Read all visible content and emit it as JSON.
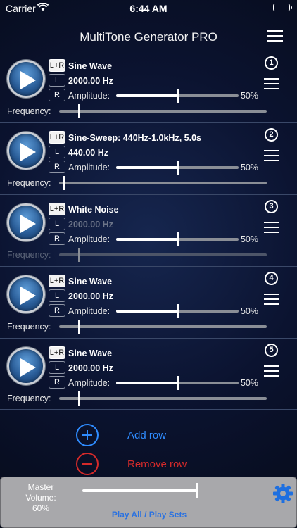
{
  "status_bar": {
    "carrier": "Carrier",
    "time": "6:44 AM"
  },
  "nav": {
    "title": "MultiTone Generator PRO",
    "menu_icon": "hamburger-menu-icon"
  },
  "rows": [
    {
      "number": "1",
      "channel": "L+R",
      "left": "L",
      "right": "R",
      "wave": "Sine Wave",
      "frequency": "2000.00 Hz",
      "frequency_enabled": true,
      "amplitude_label": "Amplitude:",
      "amplitude_pct": "50%",
      "amplitude": 0.5,
      "frequency_label": "Frequency:",
      "frequency_slider": 0.09
    },
    {
      "number": "2",
      "channel": "L+R",
      "left": "L",
      "right": "R",
      "wave": "Sine-Sweep: 440Hz-1.0kHz, 5.0s",
      "frequency": "440.00 Hz",
      "frequency_enabled": true,
      "amplitude_label": "Amplitude:",
      "amplitude_pct": "50%",
      "amplitude": 0.5,
      "frequency_label": "Frequency:",
      "frequency_slider": 0.02
    },
    {
      "number": "3",
      "channel": "L+R",
      "left": "L",
      "right": "R",
      "wave": "White Noise",
      "frequency": "2000.00 Hz",
      "frequency_enabled": false,
      "amplitude_label": "Amplitude:",
      "amplitude_pct": "50%",
      "amplitude": 0.5,
      "frequency_label": "Frequency:",
      "frequency_slider": 0.09
    },
    {
      "number": "4",
      "channel": "L+R",
      "left": "L",
      "right": "R",
      "wave": "Sine Wave",
      "frequency": "2000.00 Hz",
      "frequency_enabled": true,
      "amplitude_label": "Amplitude:",
      "amplitude_pct": "50%",
      "amplitude": 0.5,
      "frequency_label": "Frequency:",
      "frequency_slider": 0.09
    },
    {
      "number": "5",
      "channel": "L+R",
      "left": "L",
      "right": "R",
      "wave": "Sine Wave",
      "frequency": "2000.00 Hz",
      "frequency_enabled": true,
      "amplitude_label": "Amplitude:",
      "amplitude_pct": "50%",
      "amplitude": 0.5,
      "frequency_label": "Frequency:",
      "frequency_slider": 0.09
    }
  ],
  "actions": {
    "add_row": "Add row",
    "remove_row": "Remove row"
  },
  "footer": {
    "master_volume_label": "Master Volume:",
    "master_volume_pct": "60%",
    "master_volume": 0.6,
    "play_all": "Play All / Play Sets",
    "settings_icon": "gear-icon"
  },
  "colors": {
    "accent_blue": "#2f8cff",
    "remove_red": "#d42a2a",
    "play_all_blue": "#2b72e0",
    "panel_grey": "#a8a8ab"
  }
}
